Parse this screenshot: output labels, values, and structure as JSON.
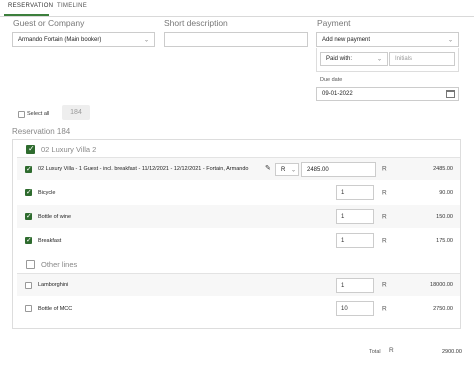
{
  "tabs": [
    {
      "label": "RESERVATION",
      "active": true
    },
    {
      "label": "TIMELINE",
      "active": false
    }
  ],
  "guest": {
    "label": "Guest or Company",
    "value": "Armando Fortain (Main booker)"
  },
  "description": {
    "label": "Short description",
    "value": ""
  },
  "payment": {
    "label": "Payment",
    "select_value": "Add new payment",
    "paid_with_label": "Paid with:",
    "initials_placeholder": "Initials",
    "due_date_label": "Due date",
    "due_date_value": "09-01-2022"
  },
  "select_all": {
    "label": "Select all",
    "count": "184"
  },
  "reservation_title": "Reservation 184",
  "group1": {
    "title": "02 Luxury Villa 2",
    "checked": true,
    "main_line": {
      "text": "02 Luxury Villa - 1 Guest - incl. breakfast - 11/12/2021 - 12/12/2021 - Fortain, Armando",
      "currency_select": "R",
      "price": "2485.00",
      "currency": "R",
      "amount": "2485.00"
    },
    "items": [
      {
        "name": "Bicycle",
        "qty": "1",
        "currency": "R",
        "amount": "90.00",
        "checked": true
      },
      {
        "name": "Bottle of wine",
        "qty": "1",
        "currency": "R",
        "amount": "150.00",
        "checked": true
      },
      {
        "name": "Breakfast",
        "qty": "1",
        "currency": "R",
        "amount": "175.00",
        "checked": true
      }
    ]
  },
  "group2": {
    "title": "Other lines",
    "checked": false,
    "items": [
      {
        "name": "Lamborghini",
        "qty": "1",
        "currency": "R",
        "amount": "18000.00",
        "checked": false
      },
      {
        "name": "Bottle of MCC",
        "qty": "10",
        "currency": "R",
        "amount": "2750.00",
        "checked": false
      }
    ]
  },
  "total": {
    "label": "Total",
    "currency": "R",
    "amount": "2900.00"
  },
  "colors": {
    "accent": "#2e6b2e",
    "border": "#cccccc"
  }
}
